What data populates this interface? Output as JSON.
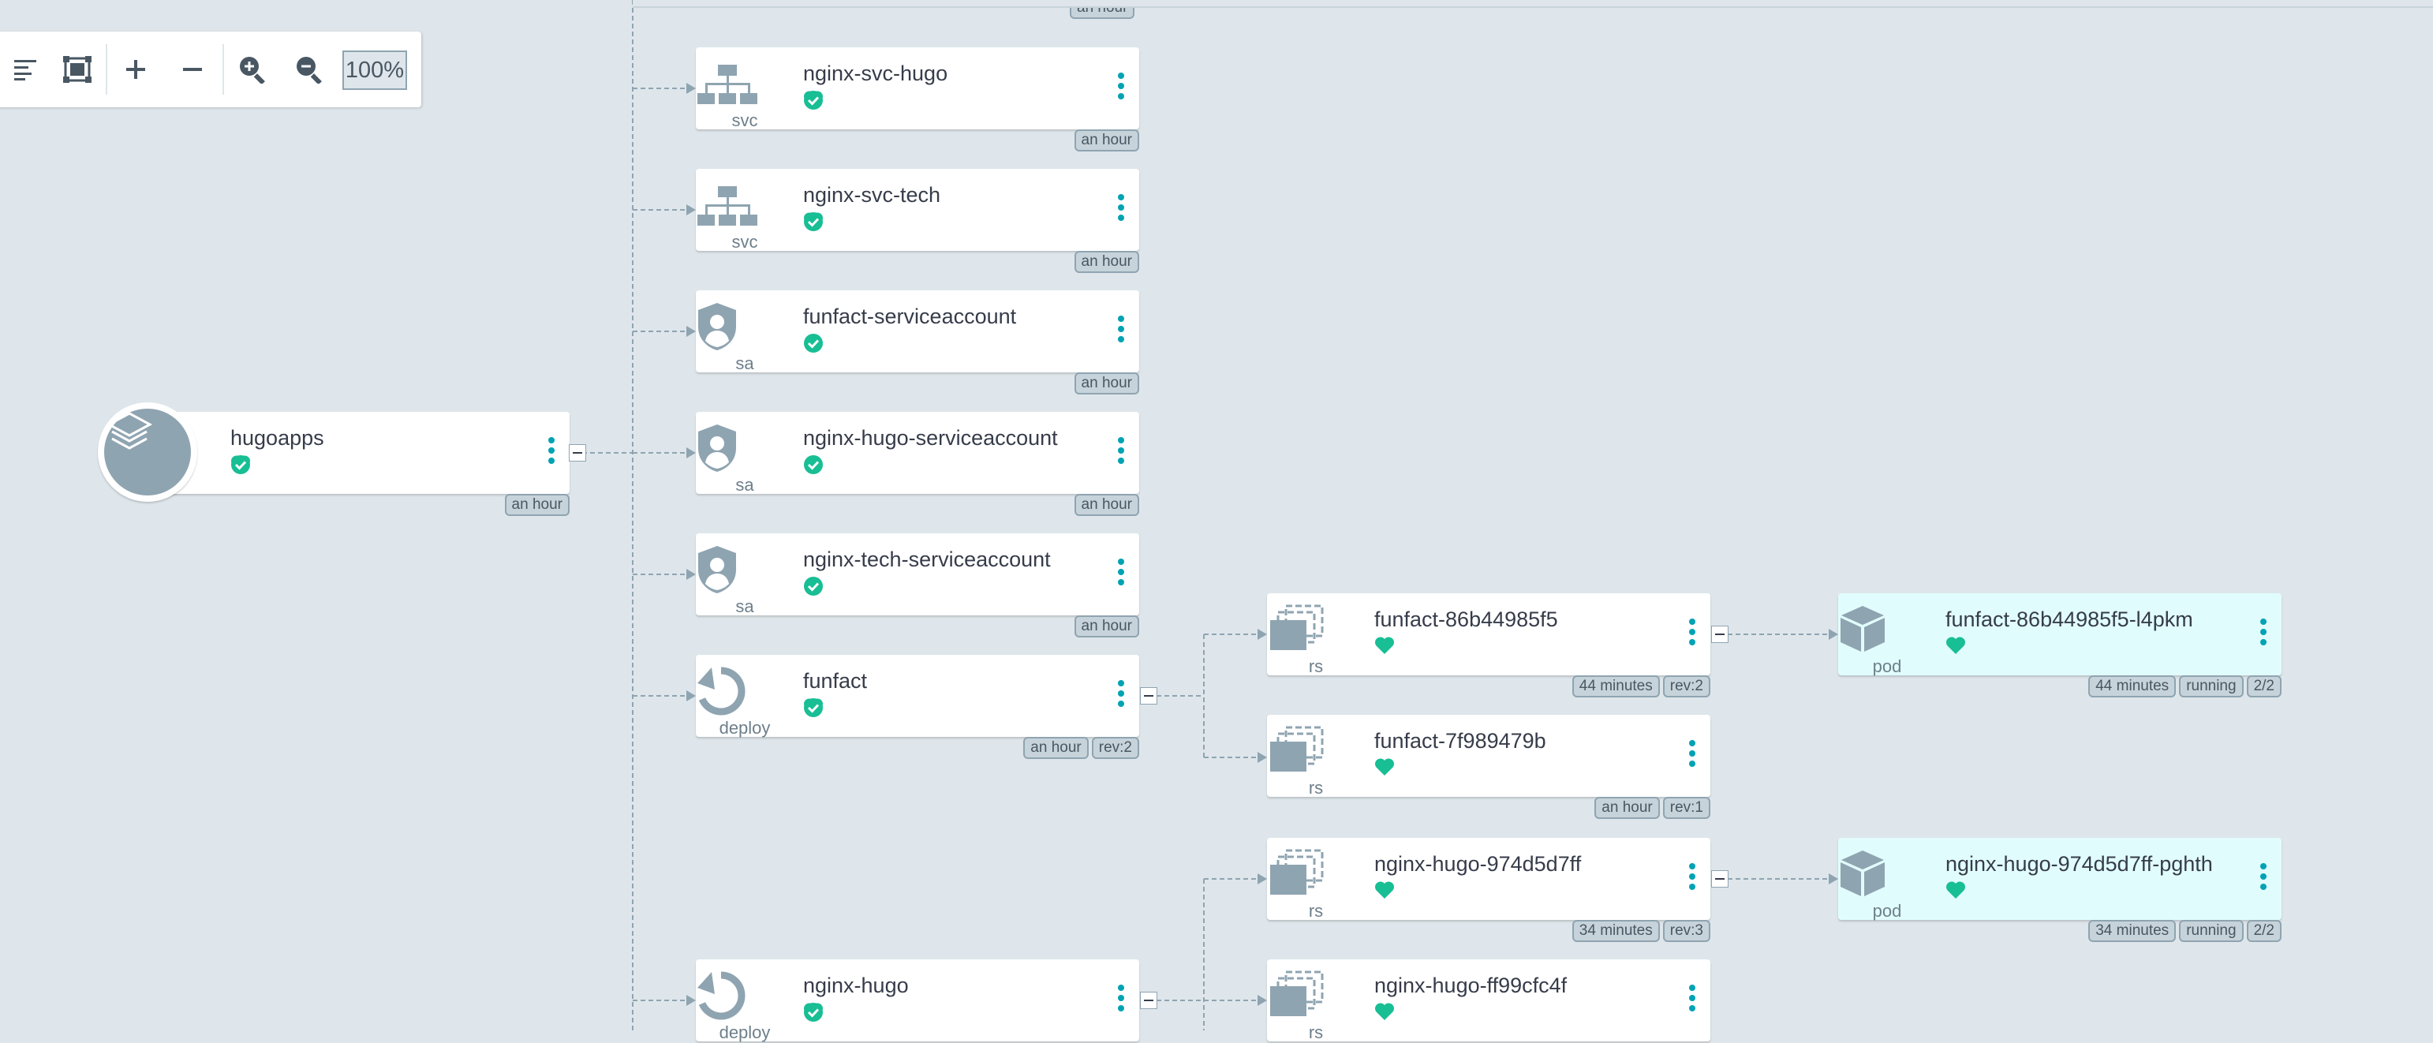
{
  "toolbar": {
    "zoom_label": "100%",
    "buttons": [
      "align-left-icon",
      "fit-screen-icon",
      "plus-icon",
      "minus-icon",
      "zoom-in-icon",
      "zoom-out-icon"
    ]
  },
  "colors": {
    "background": "#dee6eb",
    "accent": "#00a2b3",
    "healthy": "#18be94",
    "icon_gray": "#8fa4b1",
    "pod_background": "#e1fcfc"
  },
  "app": {
    "name": "hugoapps",
    "icon": "layers-icon",
    "status": [
      "healthy",
      "synced"
    ],
    "tags": [
      "an hour"
    ]
  },
  "top_partial_tag": "an hour",
  "nodes": [
    {
      "name": "nginx-svc-hugo",
      "kind": "svc",
      "icon": "service-icon",
      "status": [
        "healthy",
        "synced"
      ],
      "tags": [
        "an hour"
      ]
    },
    {
      "name": "nginx-svc-tech",
      "kind": "svc",
      "icon": "service-icon",
      "status": [
        "healthy",
        "synced"
      ],
      "tags": [
        "an hour"
      ]
    },
    {
      "name": "funfact-serviceaccount",
      "kind": "sa",
      "icon": "serviceaccount-icon",
      "status": [
        "synced"
      ],
      "tags": [
        "an hour"
      ]
    },
    {
      "name": "nginx-hugo-serviceaccount",
      "kind": "sa",
      "icon": "serviceaccount-icon",
      "status": [
        "synced"
      ],
      "tags": [
        "an hour"
      ]
    },
    {
      "name": "nginx-tech-serviceaccount",
      "kind": "sa",
      "icon": "serviceaccount-icon",
      "status": [
        "synced"
      ],
      "tags": [
        "an hour"
      ]
    },
    {
      "name": "funfact",
      "kind": "deploy",
      "icon": "deployment-icon",
      "status": [
        "healthy",
        "synced"
      ],
      "tags": [
        "an hour",
        "rev:2"
      ]
    },
    {
      "name": "nginx-hugo",
      "kind": "deploy",
      "icon": "deployment-icon",
      "status": [
        "healthy",
        "synced"
      ],
      "tags": []
    },
    {
      "name": "funfact-86b44985f5",
      "kind": "rs",
      "icon": "replicaset-icon",
      "status": [
        "healthy"
      ],
      "tags": [
        "44 minutes",
        "rev:2"
      ]
    },
    {
      "name": "funfact-7f989479b",
      "kind": "rs",
      "icon": "replicaset-icon",
      "status": [
        "healthy"
      ],
      "tags": [
        "an hour",
        "rev:1"
      ]
    },
    {
      "name": "nginx-hugo-974d5d7ff",
      "kind": "rs",
      "icon": "replicaset-icon",
      "status": [
        "healthy"
      ],
      "tags": [
        "34 minutes",
        "rev:3"
      ]
    },
    {
      "name": "nginx-hugo-ff99cfc4f",
      "kind": "rs",
      "icon": "replicaset-icon",
      "status": [
        "healthy"
      ],
      "tags": []
    },
    {
      "name": "funfact-86b44985f5-l4pkm",
      "kind": "pod",
      "icon": "pod-icon",
      "status": [
        "healthy"
      ],
      "tags": [
        "44 minutes",
        "running",
        "2/2"
      ]
    },
    {
      "name": "nginx-hugo-974d5d7ff-pghth",
      "kind": "pod",
      "icon": "pod-icon",
      "status": [
        "healthy"
      ],
      "tags": [
        "34 minutes",
        "running",
        "2/2"
      ]
    }
  ]
}
